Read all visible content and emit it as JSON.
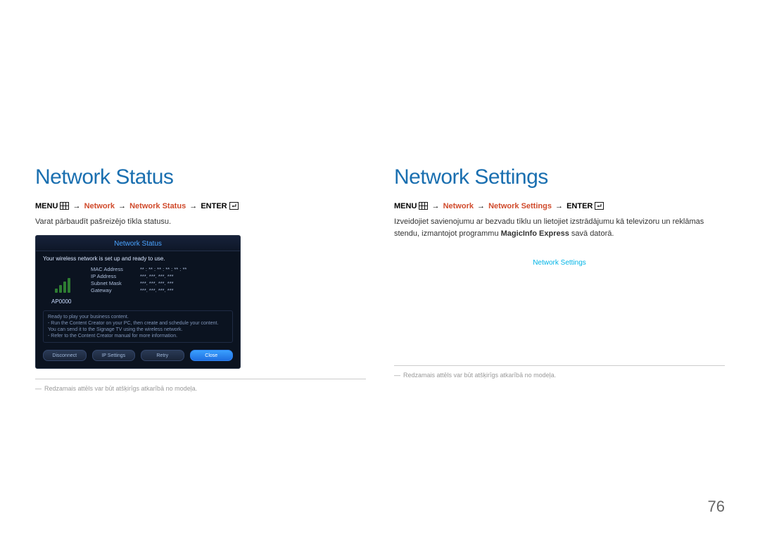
{
  "page_number": "76",
  "left": {
    "heading": "Network Status",
    "bc_menu": "MENU",
    "bc_arrow": "→",
    "bc_path1": "Network",
    "bc_path2": "Network Status",
    "bc_enter": "ENTER",
    "desc": "Varat pārbaudīt pašreizējo tīkla statusu.",
    "footnote_dash": "―",
    "footnote": "Redzamais attēls var būt atšķirīgs atkarībā no modeļa.",
    "dlg": {
      "title": "Network Status",
      "msg": "Your wireless network is set up and ready to use.",
      "ap": "AP0000",
      "kv": {
        "mac_k": "MAC Address",
        "mac_v": "**  :  **  :  **  :  **  :  **  :  **",
        "ip_k": "IP Address",
        "ip_v": "***.  ***.  ***.  ***",
        "sm_k": "Subnet Mask",
        "sm_v": "***.  ***.  ***.  ***",
        "gw_k": "Gateway",
        "gw_v": "***.  ***.  ***.  ***"
      },
      "note_l1": "Ready to play your business content.",
      "note_l2": "- Run the Content Creator on your PC, then create and schedule your content. You can send it to the Signage TV using the wireless network.",
      "note_l3": "- Refer to the Content Creator manual for more information.",
      "btn1": "Disconnect",
      "btn2": "IP Settings",
      "btn3": "Retry",
      "btn4": "Close"
    }
  },
  "right": {
    "heading": "Network Settings",
    "bc_menu": "MENU",
    "bc_arrow": "→",
    "bc_path1": "Network",
    "bc_path2": "Network Settings",
    "bc_enter": "ENTER",
    "desc_pre": "Izveidojiet savienojumu ar bezvadu tīklu un lietojiet izstrādājumu kā televizoru un reklāmas stendu, izmantojot programmu ",
    "desc_bold": "MagicInfo Express",
    "desc_post": " savā datorā.",
    "link": "Network Settings",
    "footnote_dash": "―",
    "footnote": "Redzamais attēls var būt atšķirīgs atkarībā no modeļa."
  }
}
